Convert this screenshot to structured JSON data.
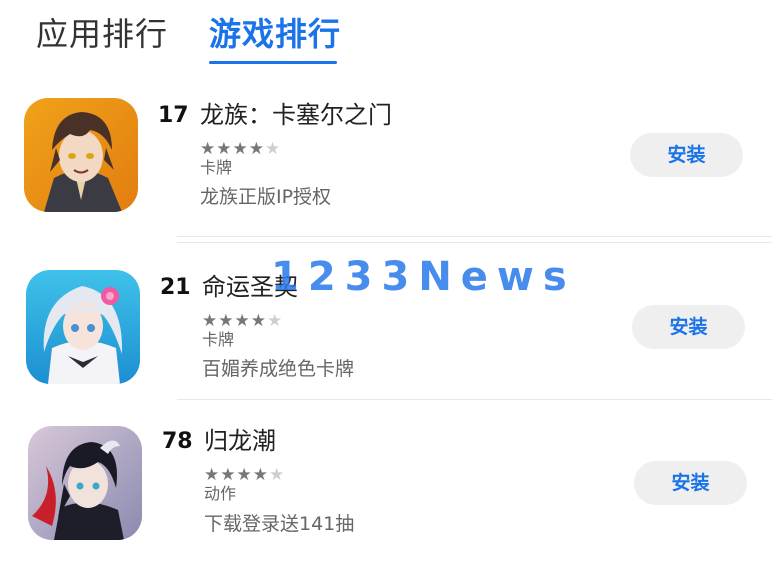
{
  "tabs": [
    {
      "label": "应用排行",
      "active": false
    },
    {
      "label": "游戏排行",
      "active": true
    }
  ],
  "colors": {
    "accent": "#1a73e8",
    "install_bg": "#efefef",
    "star_on": "#777777",
    "star_off": "#cfcfcf"
  },
  "apps": [
    {
      "rank": "17",
      "name": "龙族：卡塞尔之门",
      "rating_stars": 4,
      "category": "卡牌",
      "description": "龙族正版IP授权",
      "install_label": "安装",
      "icon": "game-icon-longzu"
    },
    {
      "rank": "21",
      "name": "命运圣契",
      "rating_stars": 4,
      "category": "卡牌",
      "description": "百媚养成绝色卡牌",
      "install_label": "安装",
      "icon": "game-icon-mingyun"
    },
    {
      "rank": "78",
      "name": "归龙潮",
      "rating_stars": 4,
      "category": "动作",
      "description": "下载登录送141抽",
      "install_label": "安装",
      "icon": "game-icon-guilongchao"
    }
  ],
  "watermark": "1233News"
}
